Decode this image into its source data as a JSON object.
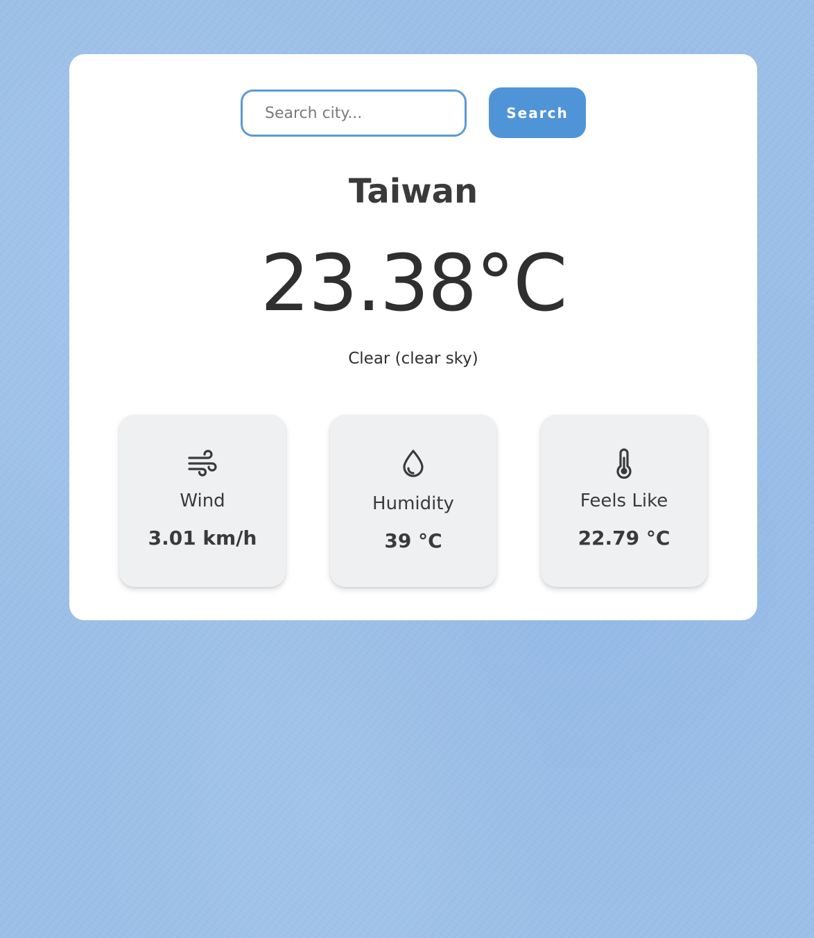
{
  "search": {
    "placeholder": "Search city...",
    "value": "",
    "button_label": "Search"
  },
  "weather": {
    "city": "Taiwan",
    "temperature": "23.38°C",
    "condition": "Clear (clear sky)"
  },
  "tiles": [
    {
      "icon": "wind-icon",
      "label": "Wind",
      "value": "3.01 km/h"
    },
    {
      "icon": "water-drop-icon",
      "label": "Humidity",
      "value": "39 °C"
    },
    {
      "icon": "thermometer-icon",
      "label": "Feels Like",
      "value": "22.79 °C"
    }
  ],
  "colors": {
    "background": "#9bbfe7",
    "card": "#ffffff",
    "accent": "#5094d8",
    "tile": "#eff0f2",
    "text": "#3a3a3a"
  }
}
